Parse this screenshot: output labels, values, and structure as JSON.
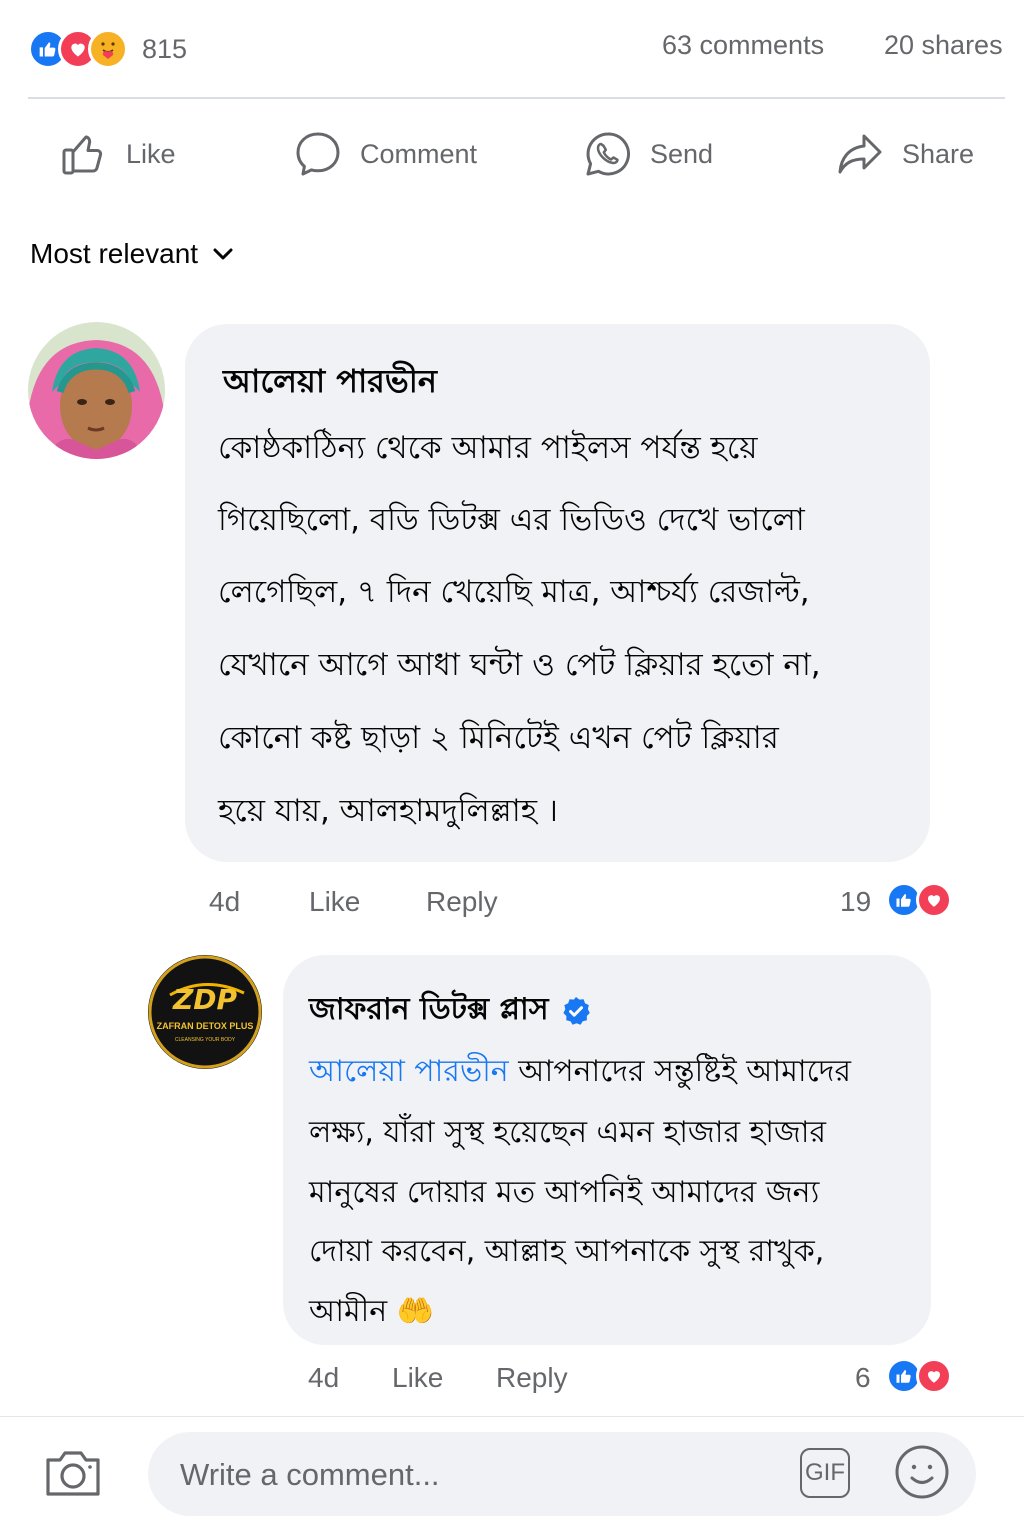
{
  "stats": {
    "reaction_total": "815",
    "comments": "63 comments",
    "shares": "20 shares",
    "reaction_icons": [
      "like-icon",
      "love-icon",
      "care-icon"
    ]
  },
  "actions": {
    "like": "Like",
    "comment": "Comment",
    "send": "Send",
    "share": "Share"
  },
  "sort": {
    "label": "Most relevant"
  },
  "comments": [
    {
      "name": "আলেয়া পারভীন",
      "lines": [
        "কোষ্ঠকাঠিন্য থেকে আমার পাইলস পর্যন্ত হয়ে",
        "গিয়েছিলো, বডি ডিটক্স এর ভিডিও দেখে ভালো",
        "লেগেছিল, ৭ দিন খেয়েছি মাত্র, আশ্চর্য্য রেজাল্ট,",
        "যেখানে আগে আধা ঘন্টা ও পেট ক্লিয়ার হতো না,",
        "কোনো কষ্ট ছাড়া ২ মিনিটেই এখন পেট ক্লিয়ার",
        "হয়ে যায়, আলহামদুলিল্লাহ ।"
      ],
      "time": "4d",
      "like": "Like",
      "reply": "Reply",
      "reaction_count": "19"
    },
    {
      "name": "জাফরান ডিটক্স প্লাস",
      "verified": true,
      "avatar_text": "ZDP",
      "avatar_caption": "ZAFRAN DETOX PLUS",
      "avatar_tagline": "CLEANSING YOUR BODY",
      "mention": "আলেয়া পারভীন",
      "first_line_rest": " আপনাদের সন্তুষ্টিই আমাদের",
      "lines": [
        "লক্ষ্য, যাঁরা সুস্থ হয়েছেন এমন হাজার হাজার",
        "মানুষের দোয়ার মত আপনিই আমাদের জন্য",
        "দোয়া করবেন, আল্লাহ আপনাকে সুস্থ রাখুক,",
        "আমীন 🤲"
      ],
      "time": "4d",
      "like": "Like",
      "reply": "Reply",
      "reaction_count": "6"
    }
  ],
  "composer": {
    "placeholder": "Write a comment...",
    "gif": "GIF"
  },
  "colors": {
    "accent": "#1877f2",
    "love": "#f33e58",
    "muted_text": "#65676b",
    "bubble": "#f0f2f5"
  }
}
